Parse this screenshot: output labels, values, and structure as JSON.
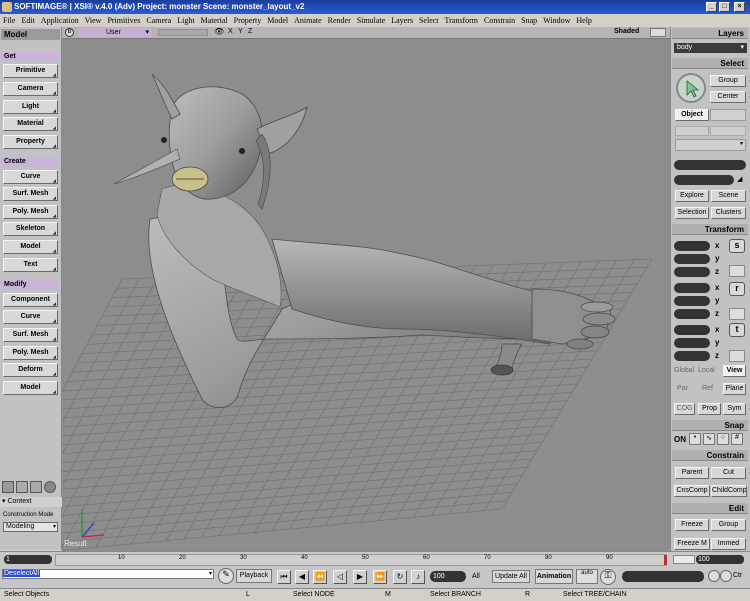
{
  "window": {
    "title": "SOFTIMAGE® | XSI® v.4.0 (Adv) Project: monster    Scene: monster_layout_v2",
    "min": "_",
    "max": "□",
    "close": "×"
  },
  "menu": [
    "File",
    "Edit",
    "Application",
    "View",
    "Primitives",
    "Camera",
    "Light",
    "Material",
    "Property",
    "Model",
    "Animate",
    "Render",
    "Simulate",
    "Layers",
    "Select",
    "Transform",
    "Constrain",
    "Snap",
    "Window",
    "Help"
  ],
  "left": {
    "mode": "Model",
    "get_header": "Get",
    "get_items": [
      "Primitive",
      "Camera",
      "Light",
      "Material",
      "Property"
    ],
    "create_header": "Create",
    "create_items": [
      "Curve",
      "Surf. Mesh",
      "Poly. Mesh",
      "Skeleton",
      "Model",
      "Text"
    ],
    "modify_header": "Modify",
    "modify_items": [
      "Component",
      "Curve",
      "Surf. Mesh",
      "Poly. Mesh",
      "Deform",
      "Model"
    ],
    "context_label": "Context",
    "construction_mode_label": "Construction Mode",
    "construction_mode_value": "Modeling"
  },
  "viewport": {
    "camera": "User",
    "display_mode": "Shaded",
    "result_label": "Result",
    "axes": [
      "X",
      "Y",
      "Z"
    ]
  },
  "right": {
    "layers_header": "Layers",
    "layer_value": "body",
    "select_header": "Select",
    "group": "Group",
    "center": "Center",
    "object": "Object",
    "explore": "Explore",
    "scene": "Scene",
    "selection": "Selection",
    "clusters": "Clusters",
    "transform_header": "Transform",
    "axes": [
      "x",
      "y",
      "z"
    ],
    "scale_icon": "s",
    "rotate_icon": "r",
    "translate_icon": "t",
    "global": "Global",
    "local": "Local",
    "view": "View",
    "par": "Par",
    "ref": "Ref",
    "plane": "Plane",
    "cog": "COG",
    "prop": "Prop",
    "sym": "Sym",
    "snap_header": "Snap",
    "snap_on": "ON",
    "constrain_header": "Constrain",
    "parent": "Parent",
    "cut": "Cut",
    "cnscomp": "CnsComp",
    "childcomp": "ChildComp",
    "edit_header": "Edit",
    "freeze": "Freeze",
    "group_edit": "Group",
    "freeze_m": "Freeze M",
    "immed": "Immed"
  },
  "timeline": {
    "start": "1",
    "ticks": [
      "10",
      "20",
      "30",
      "40",
      "50",
      "60",
      "70",
      "80",
      "90"
    ],
    "end_field": "100",
    "end_value": "100"
  },
  "command": {
    "script_text": "DeselectAll",
    "playback": "Playback",
    "frame_value": "100",
    "all": "All",
    "update_all": "Update All",
    "animation": "Animation",
    "auto": "auto",
    "ctr": "Ctr"
  },
  "status": {
    "left": "Select Objects",
    "l_key": "L",
    "select_node": "Select NODE",
    "m_key": "M",
    "select_branch": "Select BRANCH",
    "r_key": "R",
    "select_tree": "Select TREE/CHAIN"
  },
  "colors": {
    "titlebar": "#2a5bd6",
    "viewport_bg": "#8d8d8d",
    "section_header": "#c9b4d8",
    "select_accent": "#7ec6a0"
  }
}
